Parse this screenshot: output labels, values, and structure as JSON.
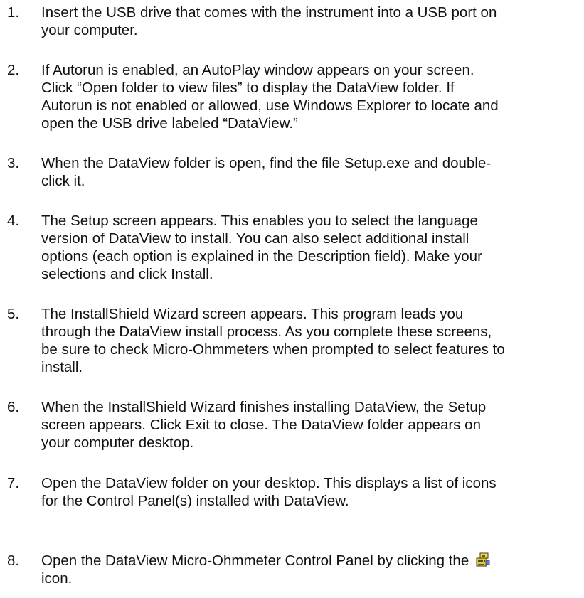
{
  "steps": [
    {
      "number": "1.",
      "lines": [
        "Insert the USB drive that comes with the instrument into a USB port on",
        "your computer."
      ]
    },
    {
      "number": "2.",
      "lines": [
        "If Autorun is enabled, an AutoPlay window appears on your screen.",
        "Click “Open folder to view files” to display the DataView folder. If",
        "Autorun is not enabled or allowed, use Windows Explorer to locate and",
        "open the USB drive labeled “DataView.”"
      ]
    },
    {
      "number": "3.",
      "lines": [
        "When the DataView folder is open, find the file Setup.exe and double-",
        "click it."
      ]
    },
    {
      "number": "4.",
      "lines": [
        "The Setup screen appears. This enables you to select the language",
        "version of DataView to install. You can also select additional install",
        "options (each option is explained in the Description field). Make your",
        "selections and click Install."
      ]
    },
    {
      "number": "5.",
      "lines": [
        "The InstallShield Wizard screen appears. This program leads you",
        "through the DataView install process. As you complete these screens,",
        "be sure to check Micro-Ohmmeters when prompted to select features to",
        "install."
      ]
    },
    {
      "number": "6.",
      "lines": [
        "When the InstallShield Wizard finishes installing DataView, the Setup",
        "screen appears. Click Exit to close. The DataView folder appears on",
        "your computer desktop."
      ]
    },
    {
      "number": "7.",
      "lines": [
        "Open the DataView folder on your desktop. This displays a list of icons",
        "for the Control Panel(s) installed with DataView."
      ]
    },
    {
      "number": "8.",
      "line1": "Open the DataView Micro-Ohmmeter Control Panel by clicking the",
      "line2": "icon.",
      "icon": "micro-ohmmeter-control-panel-icon"
    }
  ]
}
